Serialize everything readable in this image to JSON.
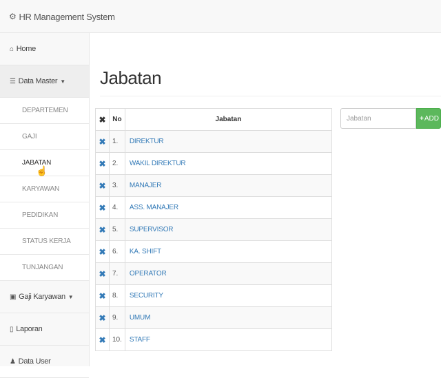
{
  "app": {
    "title": "HR Management System",
    "brand_icon": "cogs-icon"
  },
  "sidebar": {
    "home": {
      "label": "Home",
      "icon": "home-icon"
    },
    "data_master": {
      "label": "Data Master",
      "icon": "database-icon"
    },
    "data_master_items": [
      {
        "label": "DEPARTEMEN"
      },
      {
        "label": "GAJI"
      },
      {
        "label": "JABATAN"
      },
      {
        "label": "KARYAWAN"
      },
      {
        "label": "PEDIDIKAN"
      },
      {
        "label": "STATUS KERJA"
      },
      {
        "label": "TUNJANGAN"
      }
    ],
    "gaji_karyawan": {
      "label": "Gaji Karyawan",
      "icon": "money-icon"
    },
    "laporan": {
      "label": "Laporan",
      "icon": "file-icon"
    },
    "data_user": {
      "label": "Data User",
      "icon": "users-icon"
    }
  },
  "main": {
    "title": "Jabatan",
    "table": {
      "headers": {
        "delete": "✖",
        "no": "No",
        "name": "Jabatan"
      },
      "rows": [
        {
          "no": "1.",
          "name": "DIREKTUR"
        },
        {
          "no": "2.",
          "name": "WAKIL DIREKTUR"
        },
        {
          "no": "3.",
          "name": "MANAJER"
        },
        {
          "no": "4.",
          "name": "ASS. MANAJER"
        },
        {
          "no": "5.",
          "name": "SUPERVISOR"
        },
        {
          "no": "6.",
          "name": "KA. SHIFT"
        },
        {
          "no": "7.",
          "name": "OPERATOR"
        },
        {
          "no": "8.",
          "name": "SECURITY"
        },
        {
          "no": "9.",
          "name": "UMUM"
        },
        {
          "no": "10.",
          "name": "STAFF"
        }
      ]
    },
    "form": {
      "placeholder": "Jabatan",
      "add_label": "ADD"
    }
  },
  "colors": {
    "link": "#337ab7",
    "add_button": "#5cb85c"
  }
}
